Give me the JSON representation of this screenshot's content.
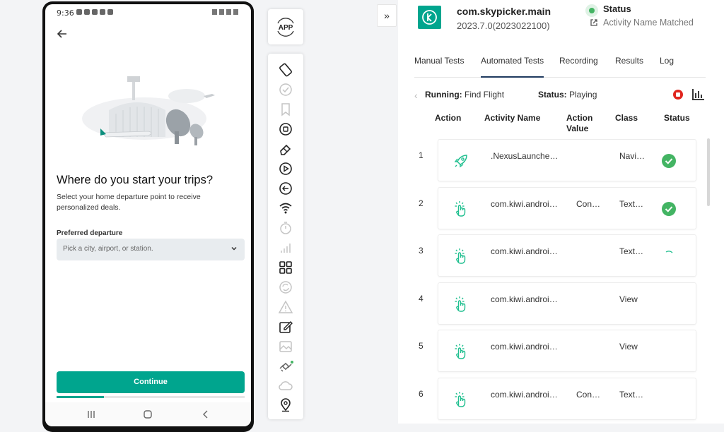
{
  "phone": {
    "time": "9:36",
    "title": "Where do you start your trips?",
    "subtitle": "Select your home departure point to receive personalized deals.",
    "field_label": "Preferred departure",
    "field_placeholder": "Pick a city, airport, or station.",
    "continue_label": "Continue",
    "progress": 0.25,
    "accent": "#00a58e"
  },
  "toolbar": {
    "app_label": "APP",
    "tools": [
      "rotate-icon",
      "check-circle-icon",
      "bookmark-icon",
      "record-icon",
      "eraser-icon",
      "play-icon",
      "back-icon",
      "wifi-icon",
      "timer-icon",
      "signal-icon",
      "grid-icon",
      "sync-icon",
      "warning-icon",
      "edit-icon",
      "image-icon",
      "satellite-icon",
      "cloud-icon",
      "location-icon"
    ]
  },
  "header": {
    "app_name": "com.skypicker.main",
    "app_version": "2023.7.0(2023022100)",
    "status_title": "Status",
    "status_subtitle": "Activity Name Matched"
  },
  "tabs": [
    "Manual Tests",
    "Automated Tests",
    "Recording",
    "Results",
    "Log"
  ],
  "active_tab": "Automated Tests",
  "running": {
    "running_label": "Running:",
    "running_value": "Find Flight",
    "status_label": "Status:",
    "status_value": "Playing"
  },
  "columns": {
    "action": "Action",
    "activity": "Activity Name",
    "action_value_1": "Action",
    "action_value_2": "Value",
    "class": "Class",
    "status": "Status"
  },
  "rows": [
    {
      "num": "1",
      "icon": "rocket-icon",
      "activity": ".NexusLaunche…",
      "value": "",
      "class": "Navi…",
      "status": "passed"
    },
    {
      "num": "2",
      "icon": "tap-icon",
      "activity": "com.kiwi.androi…",
      "value": "Con…",
      "class": "Text…",
      "status": "passed"
    },
    {
      "num": "3",
      "icon": "tap-icon",
      "activity": "com.kiwi.androi…",
      "value": "",
      "class": "Text…",
      "status": "running"
    },
    {
      "num": "4",
      "icon": "tap-icon",
      "activity": "com.kiwi.androi…",
      "value": "",
      "class": "View",
      "status": "pending"
    },
    {
      "num": "5",
      "icon": "tap-icon",
      "activity": "com.kiwi.androi…",
      "value": "",
      "class": "View",
      "status": "pending"
    },
    {
      "num": "6",
      "icon": "tap-icon",
      "activity": "com.kiwi.androi…",
      "value": "Con…",
      "class": "Text…",
      "status": "pending"
    }
  ],
  "colors": {
    "success": "#43b463",
    "danger": "#e0251e",
    "action_icon": "#1fbf8f",
    "tab_underline": "#1f3a5f"
  }
}
